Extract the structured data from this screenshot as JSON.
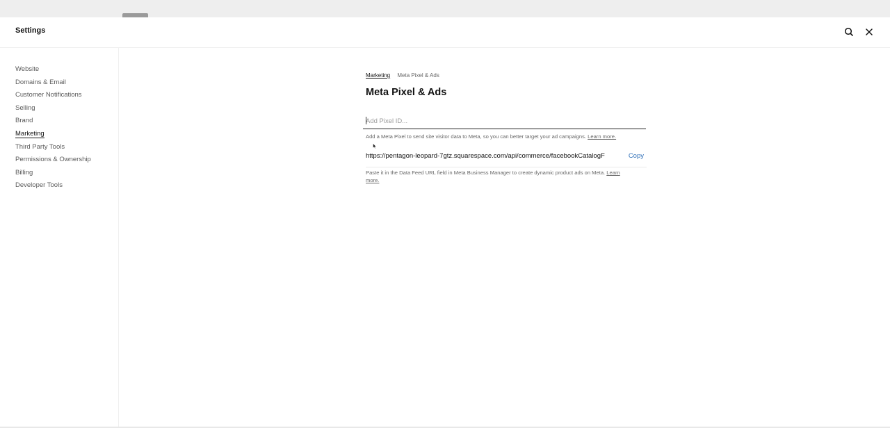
{
  "header": {
    "title": "Settings",
    "search_icon": "search-icon",
    "close_icon": "close-icon"
  },
  "sidebar": {
    "items": [
      {
        "label": "Website"
      },
      {
        "label": "Domains & Email"
      },
      {
        "label": "Customer Notifications"
      },
      {
        "label": "Selling"
      },
      {
        "label": "Brand"
      },
      {
        "label": "Marketing",
        "active": true
      },
      {
        "label": "Third Party Tools"
      },
      {
        "label": "Permissions & Ownership"
      },
      {
        "label": "Billing"
      },
      {
        "label": "Developer Tools"
      }
    ]
  },
  "main": {
    "breadcrumb": {
      "parent": "Marketing",
      "current": "Meta Pixel & Ads"
    },
    "title": "Meta Pixel & Ads",
    "pixel_input": {
      "value": "",
      "placeholder": "Add Pixel ID..."
    },
    "pixel_help": {
      "text": "Add a Meta Pixel to send site visitor data to Meta, so you can better target your ad campaigns.",
      "link": "Learn more."
    },
    "feed": {
      "url": "https://pentagon-leopard-7gtz.squarespace.com/api/commerce/facebookCatalogF",
      "copy_label": "Copy"
    },
    "feed_help": {
      "text": "Paste it in the Data Feed URL field in Meta Business Manager to create dynamic product ads on Meta.",
      "link": "Learn more."
    }
  },
  "colors": {
    "accent": "#2e6fb8",
    "text": "#111111",
    "muted": "#666666"
  }
}
